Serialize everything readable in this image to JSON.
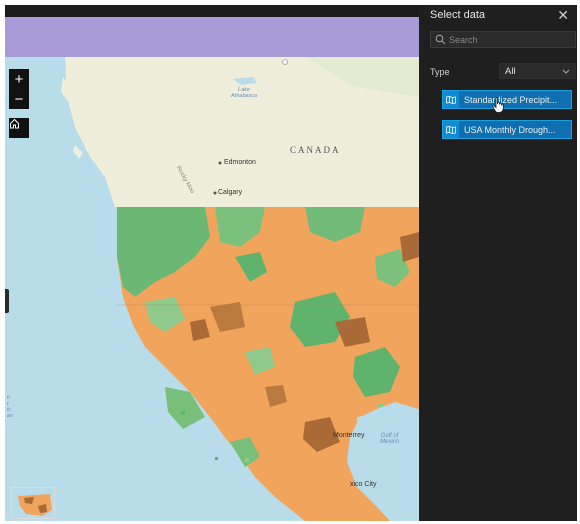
{
  "map": {
    "labels": {
      "canada": "CANADA",
      "edmonton": "Edmonton",
      "calgary": "Calgary",
      "lake_athabasca": "Lake\nAthabasca",
      "rocky": "Rocky Mou",
      "gulf_mexico": "Gulf of\nMexico",
      "monterrey": "Monterrey",
      "mexico_city": "xico City",
      "edge_text": "h\nt\nic\nan"
    },
    "controls": {
      "zoom_in_label": "+",
      "zoom_out_label": "−"
    },
    "colors": {
      "drought_orange": "#f1a45c",
      "wet_green": "#5fb36d",
      "dark_brown": "#a96a38",
      "water": "#b9dcea",
      "land": "#eeeeda"
    }
  },
  "panel": {
    "title": "Select data",
    "close_glyph": "✕",
    "search": {
      "placeholder": "Search",
      "value": ""
    },
    "type": {
      "label": "Type",
      "selected": "All"
    },
    "items": [
      {
        "label": "Standardized Precipit..."
      },
      {
        "label": "USA Monthly Drough..."
      }
    ],
    "accent": "#1aa1e0"
  }
}
